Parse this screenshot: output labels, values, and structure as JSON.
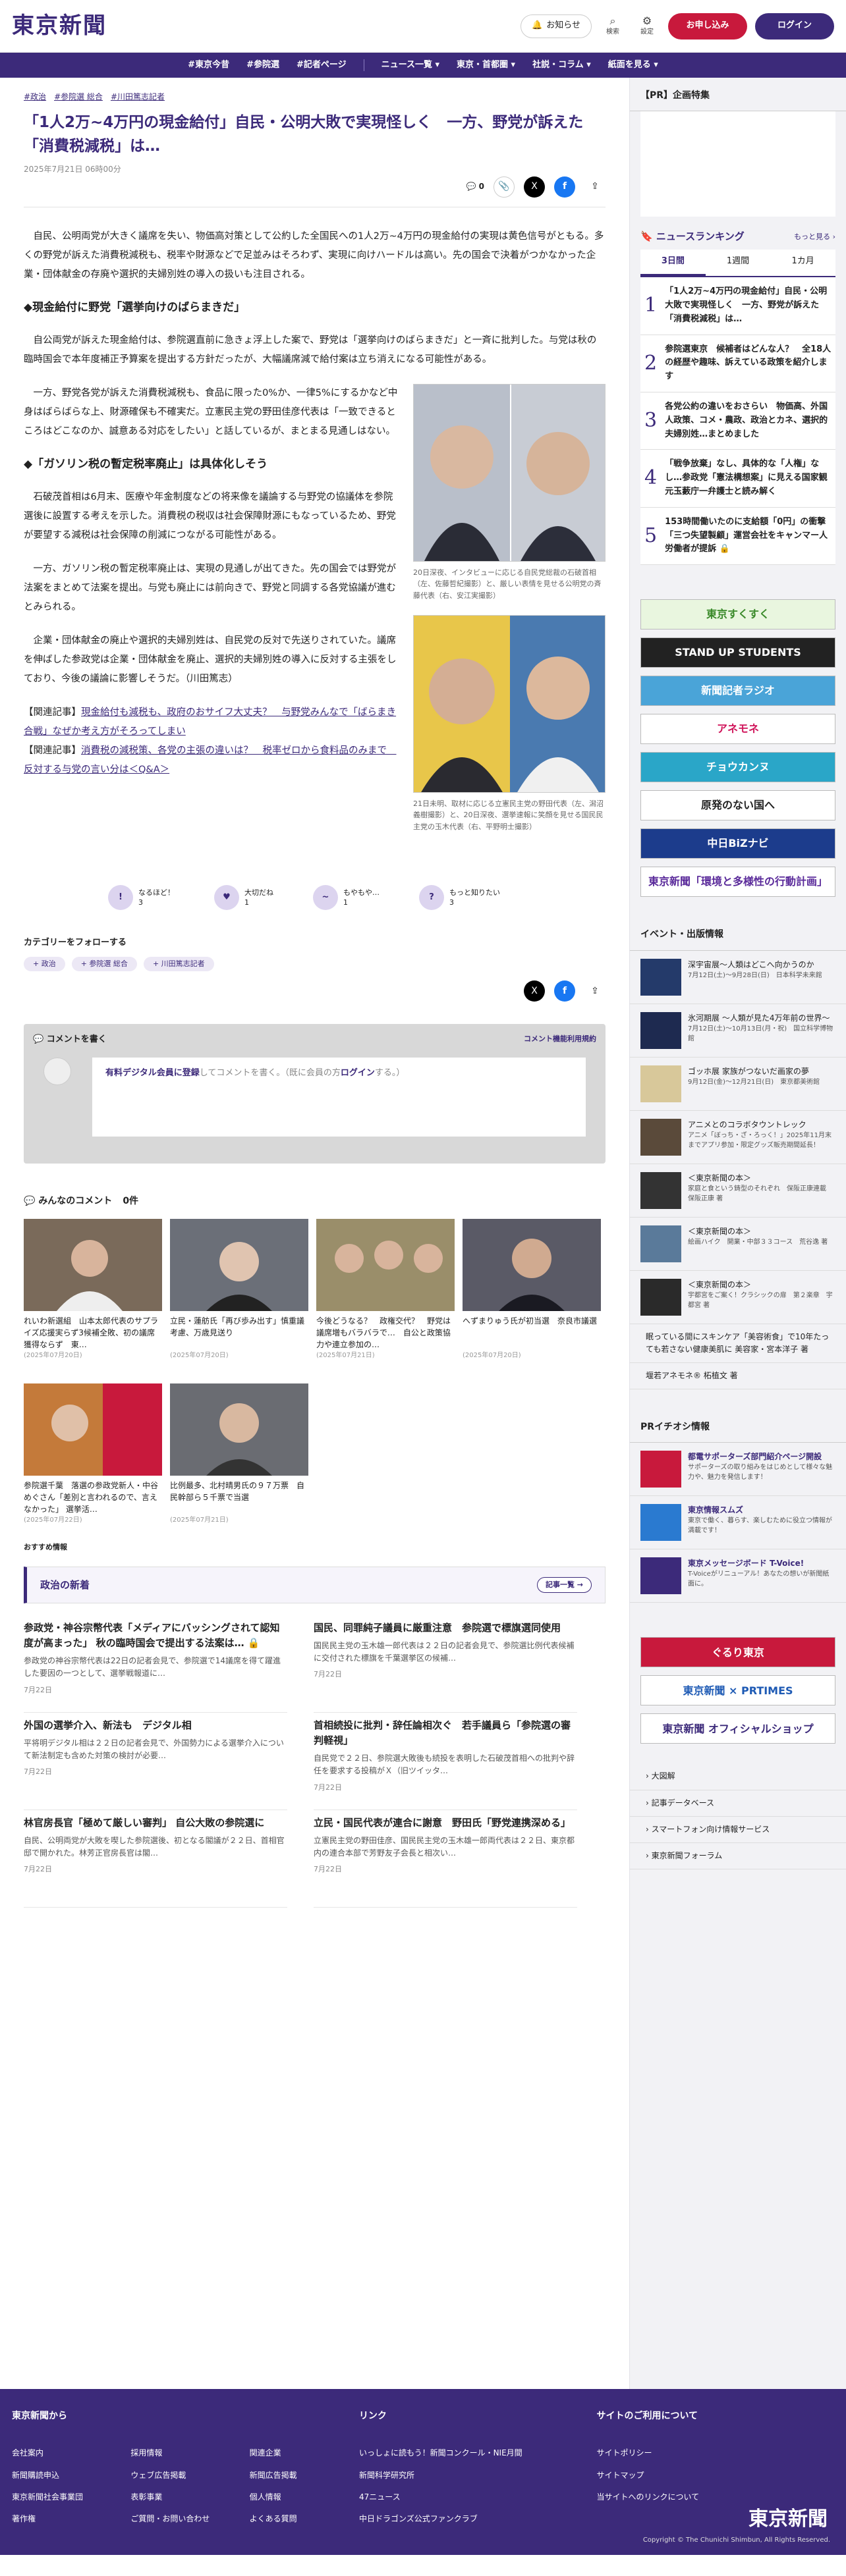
{
  "header": {
    "logo": "東京新聞",
    "notice": "お知らせ",
    "search": "検索",
    "settings": "設定",
    "apply": "お申し込み",
    "login": "ログイン"
  },
  "nav": [
    "#東京今昔",
    "#参院選",
    "#記者ページ",
    "ニュース一覧 ▾",
    "東京・首都圏 ▾",
    "社説・コラム ▾",
    "紙面を見る ▾"
  ],
  "article": {
    "tags": [
      "#政治",
      "#参院選 総合",
      "#川田篤志記者"
    ],
    "title": "「1人2万~4万円の現金給付」自民・公明大敗で実現怪しく　一方、野党が訴えた「消費税減税」は…",
    "date": "2025年7月21日 06時00分",
    "comment_count": "0",
    "p1": "自民、公明両党が大きく議席を失い、物価高対策として公約した全国民への1人2万~4万円の現金給付の実現は黄色信号がともる。多くの野党が訴えた消費税減税も、税率や財源などで足並みはそろわず、実現に向けハードルは高い。先の国会で決着がつかなかった企業・団体献金の存廃や選択的夫婦別姓の導入の扱いも注目される。",
    "h1": "◆現金給付に野党「選挙向けのばらまきだ」",
    "p2": "自公両党が訴えた現金給付は、参院選直前に急きょ浮上した案で、野党は「選挙向けのばらまきだ」と一斉に批判した。与党は秋の臨時国会で本年度補正予算案を提出する方針だったが、大幅議席減で給付案は立ち消えになる可能性がある。",
    "p3": "一方、野党各党が訴えた消費税減税も、食品に限った0%か、一律5%にするかなど中身はばらばらな上、財源確保も不確実だ。立憲民主党の野田佳彦代表は「一致できるところはどこなのか、誠意ある対応をしたい」と話しているが、まとまる見通しはない。",
    "h2": "◆「ガソリン税の暫定税率廃止」は具体化しそう",
    "p4": "石破茂首相は6月末、医療や年金制度などの将来像を議論する与野党の協議体を参院選後に設置する考えを示した。消費税の税収は社会保障財源にもなっているため、野党が要望する減税は社会保障の削減につながる可能性がある。",
    "p5": "一方、ガソリン税の暫定税率廃止は、実現の見通しが出てきた。先の国会では野党が法案をまとめて法案を提出。与党も廃止には前向きで、野党と同調する各党協議が進むとみられる。",
    "p6": "企業・団体献金の廃止や選択的夫婦別姓は、自民党の反対で先送りされていた。議席を伸ばした参政党は企業・団体献金を廃止、選択的夫婦別姓の導入に反対する主張をしており、今後の議論に影響しそうだ。（川田篤志）",
    "cap1": "20日深夜、インタビューに応じる自民党総裁の石破首相（左、佐藤哲紀撮影）と、厳しい表情を見せる公明党の斉藤代表（右、安江実撮影）",
    "cap2": "21日未明、取材に応じる立憲民主党の野田代表（左、潟沼義樹撮影）と、20日深夜、選挙速報に笑顔を見せる国民民主党の玉木代表（右、平野明士撮影）",
    "rel1_label": "【関連記事】",
    "rel1": "現金給付も減税も、政府のおサイフ大丈夫？　与野党みんなで「ばらまき合戦」なぜか考え方がそろってしまい",
    "rel2_label": "【関連記事】",
    "rel2": "消費税の減税策、各党の主張の違いは？　税率ゼロから食料品のみまで　反対する与党の言い分は＜Q&A＞"
  },
  "reactions": [
    {
      "label": "なるほど！",
      "count": "3",
      "icon": "!"
    },
    {
      "label": "大切だね",
      "count": "1",
      "icon": "♥"
    },
    {
      "label": "もやもや…",
      "count": "1",
      "icon": "~"
    },
    {
      "label": "もっと知りたい",
      "count": "3",
      "icon": "?"
    }
  ],
  "category": {
    "title": "カテゴリーをフォローする",
    "chips": [
      "+ 政治",
      "+ 参院選 総合",
      "+ 川田篤志記者"
    ]
  },
  "comment": {
    "write": "コメントを書く",
    "rules": "コメント機能利用規約",
    "hint_link": "有料デジタル会員に登録",
    "hint_mid": "してコメントを書く。（既に会員の方",
    "hint_login": "ログイン",
    "hint_end": "する。）",
    "all": "みんなのコメント",
    "all_count": "0件"
  },
  "cards": [
    {
      "title": "れいわ新選組　山本太郎代表のサプライズ応援実らず3候補全敗、初の議席獲得ならず　東…",
      "date": "(2025年07月20日)",
      "bg": "#7a6a5a"
    },
    {
      "title": "立民・蓮舫氏「再び歩み出す」慎重議考慮、万歳見送り",
      "date": "(2025年07月20日)",
      "bg": "#6b6f78"
    },
    {
      "title": "今後どうなる？　政権交代？　野党は議席増もバラバラで…　自公と政策協力や連立参加の…",
      "date": "(2025年07月21日)",
      "bg": "#9a8e6a"
    },
    {
      "title": "へずまりゅう氏が初当選　奈良市議選",
      "date": "(2025年07月20日)",
      "bg": "#5a5a66"
    },
    {
      "title": "参院選千葉　落選の参政党新人・中谷めぐさん「差別と言われるので、言えなかった」 選挙活…",
      "date": "(2025年07月22日)",
      "bg": "#c47a3a"
    },
    {
      "title": "比例最多、北村晴男氏の９７万票　自民幹部ら５千票で当選",
      "date": "(2025年07月21日)",
      "bg": "#6a6c72"
    }
  ],
  "recommend": "おすすめ情報",
  "politics": {
    "title": "政治の新着",
    "more": "記事一覧 →",
    "items": [
      {
        "title": "参政党・神谷宗幣代表「メディアにバッシングされて認知度が高まった」 秋の臨時国会で提出する法案は… 🔒",
        "ex": "参政党の神谷宗幣代表は22日の記者会見で、参院選で14議席を得て躍進した要因の一つとして、選挙戦報道に…",
        "date": "7月22日"
      },
      {
        "title": "国民、同罪純子議員に厳重注意　参院選で標旗選同使用",
        "ex": "国民民主党の玉木雄一郎代表は２２日の記者会見で、参院選比例代表候補に交付された標旗を千葉選挙区の候補…",
        "date": "7月22日"
      },
      {
        "title": "外国の選挙介入、新法も　デジタル相",
        "ex": "平将明デジタル相は２２日の記者会見で、外国勢力による選挙介入について新法制定も含めた対策の検討が必要…",
        "date": "7月22日"
      },
      {
        "title": "首相続投に批判・辞任論相次ぐ　若手議員ら「参院選の審判軽視」",
        "ex": "自民党で２２日、参院選大敗後も続投を表明した石破茂首相への批判や辞任を要求する投稿がＸ（旧ツイッタ…",
        "date": "7月22日"
      },
      {
        "title": "林官房長官「極めて厳しい審判」 自公大敗の参院選に",
        "ex": "自民、公明両党が大敗を喫した参院選後、初となる閣議が２２日、首相官邸で開かれた。林芳正官房長官は閣…",
        "date": "7月22日"
      },
      {
        "title": "立民・国民代表が連合に謝意　野田氏「野党連携深める」",
        "ex": "立憲民主党の野田佳彦、国民民主党の玉木雄一郎両代表は２２日、東京都内の連合本部で芳野友子会長と相次い…",
        "date": "7月22日"
      }
    ]
  },
  "sidebar": {
    "pr_title": "【PR】企画特集",
    "ranking_title": "ニュースランキング",
    "ranking_more": "もっと見る ›",
    "tabs": [
      "3日間",
      "1週間",
      "1カ月"
    ],
    "ranks": [
      "「1人2万~4万円の現金給付」自民・公明大敗で実現怪しく　一方、野党が訴えた「消費税減税」は…",
      "参院選東京　候補者はどんな人？　全18人の経歴や趣味、訴えている政策を紹介します",
      "各党公約の違いをおさらい　物価高、外国人政策、コメ・農政、政治とカネ、選択的夫婦別姓…まとめました",
      "「戦争放棄」なし、具体的な「人権」なし…参政党「憲法構想案」に見える国家観　元玉藪庁一弁護士と読み解く",
      "153時間働いたのに支給額「0円」の衝撃「三つ失望製顧」運営会社をキャンマー人労働者が提訴 🔒"
    ],
    "banners": [
      {
        "t": "東京すくすく",
        "bg": "#e9f6df",
        "fg": "#3a8a2a"
      },
      {
        "t": "STAND UP STUDENTS",
        "bg": "#222",
        "fg": "#fff"
      },
      {
        "t": "新聞記者ラジオ",
        "bg": "#4aa4d8",
        "fg": "#fff"
      },
      {
        "t": "アネモネ",
        "bg": "#fff",
        "fg": "#d0145a"
      },
      {
        "t": "チョウカンヌ",
        "bg": "#2aa6c8",
        "fg": "#fff"
      },
      {
        "t": "原発のない国へ",
        "bg": "#fff",
        "fg": "#222"
      },
      {
        "t": "中日BiZナビ",
        "bg": "#1c3c8c",
        "fg": "#fff"
      },
      {
        "t": "東京新聞「環境と多様性の行動計画」",
        "bg": "#fff",
        "fg": "#5a2a9a"
      }
    ],
    "events_title": "イベント・出版情報",
    "events": [
      {
        "t": "深宇宙展～人類はどこへ向かうのか",
        "s": "7月12日(土)～9月28日(日)　日本科学未来館",
        "bg": "#243a6a"
      },
      {
        "t": "氷河期展 ～人類が見た4万年前の世界～",
        "s": "7月12日(土)～10月13日(月・祝)　国立科学博物館",
        "bg": "#1e2a50"
      },
      {
        "t": "ゴッホ展 家族がつないだ画家の夢",
        "s": "9月12日(金)～12月21日(日)　東京都美術館",
        "bg": "#d8c89a"
      },
      {
        "t": "アニメとのコラボタウントレック",
        "s": "アニメ「ぼっち・ざ・ろっく！」2025年11月末までアプリ参加・限定グッズ販売期間延長！",
        "bg": "#5a4a3a"
      },
      {
        "t": "＜東京新聞の本＞",
        "s": "家庭と食という鋳型のそれぞれ　保阪正康連載　保阪正康 著",
        "bg": "#333"
      },
      {
        "t": "＜東京新聞の本＞",
        "s": "絵画ハイク　開業・中部３３コース　荒谷逸 著",
        "bg": "#5a7a9a"
      },
      {
        "t": "＜東京新聞の本＞",
        "s": "宇都宮をご案く！クラシックの扉　第２楽章　宇都宮 著",
        "bg": "#2a2a2a"
      }
    ],
    "links1": [
      "眠っている間にスキンケア「美容術食」で10年たっても若さない健康美肌に 美容家・宮本洋子 著",
      "堰若アネモネ® 柘植文 著"
    ],
    "pr2_title": "PRイチオシ情報",
    "pr2": [
      {
        "t": "都電サポーターズ部門紹介ページ開設",
        "s": "サポーターズの取り組みをはじめとして様々な魅力や、魅力を発信します！",
        "bg": "#c8193c"
      },
      {
        "t": "東京情報スムズ",
        "s": "東京で働く、暮らす、楽しむために役立つ情報が満載です！",
        "bg": "#2a7ad0"
      },
      {
        "t": "東京メッセージボード T-Voice!",
        "s": "T-Voiceがリニューアル！あなたの想いが新聞紙面に。",
        "bg": "#3c2a7a"
      }
    ],
    "banners2": [
      {
        "t": "ぐるり東京",
        "bg": "#c8193c",
        "fg": "#fff"
      },
      {
        "t": "東京新聞 × PRTIMES",
        "bg": "#fff",
        "fg": "#1e5ab4"
      },
      {
        "t": "東京新聞 オフィシャルショップ",
        "bg": "#fff",
        "fg": "#3c2a7a"
      }
    ],
    "links2": [
      "大図解",
      "記事データベース",
      "スマートフォン向け情報サービス",
      "東京新聞フォーラム"
    ]
  },
  "footer": {
    "col1_title": "東京新聞から",
    "col1": [
      "会社案内",
      "採用情報",
      "関連企業",
      "新聞購読申込",
      "ウェブ広告掲載",
      "新聞広告掲載",
      "東京新聞社会事業団",
      "表彰事業",
      "個人情報",
      "著作権",
      "ご質問・お問い合わせ",
      "よくある質問"
    ],
    "col2_title": "リンク",
    "col2": [
      "いっしょに読もう！新聞コンクール・NIE月間",
      "新聞科学研究所",
      "47ニュース",
      "中日ドラゴンズ公式ファンクラブ"
    ],
    "col3_title": "サイトのご利用について",
    "col3": [
      "サイトポリシー",
      "サイトマップ",
      "当サイトへのリンクについて"
    ],
    "logo": "東京新聞",
    "copy": "Copyright © The Chunichi Shimbun, All Rights Reserved."
  }
}
